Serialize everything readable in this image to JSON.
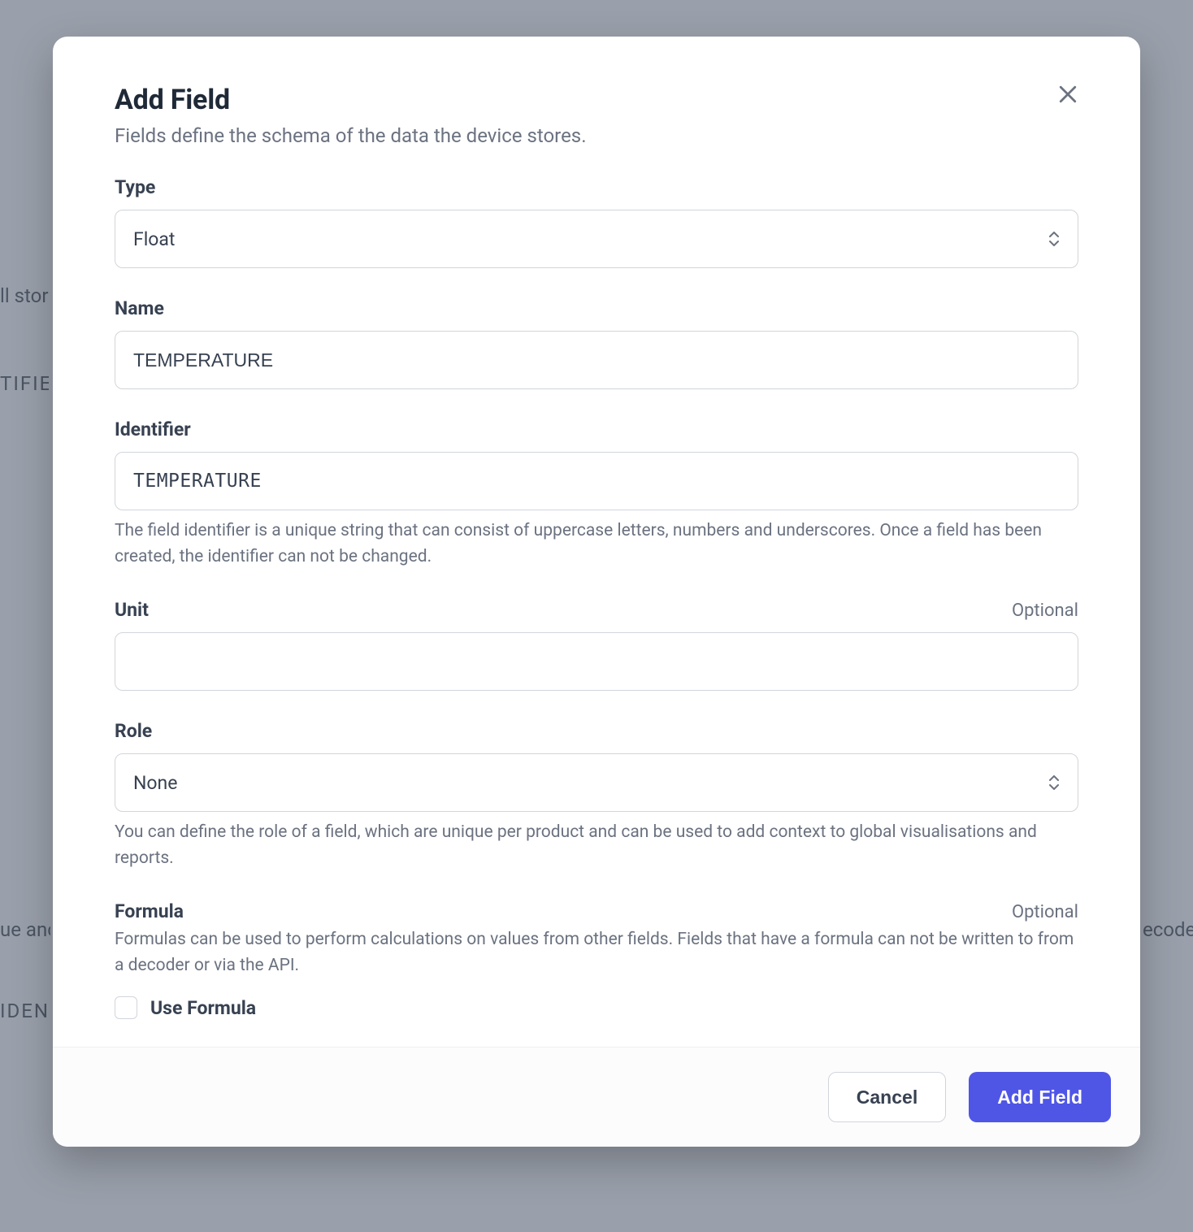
{
  "background": {
    "line1": "ll stor",
    "line2": "TIFIE",
    "line3": "ue anc",
    "line4": "IDEN",
    "line5": "ecode"
  },
  "modal": {
    "title": "Add Field",
    "subtitle": "Fields define the schema of the data the device stores.",
    "type": {
      "label": "Type",
      "value": "Float"
    },
    "name": {
      "label": "Name",
      "value": "TEMPERATURE"
    },
    "identifier": {
      "label": "Identifier",
      "value": "TEMPERATURE",
      "help": "The field identifier is a unique string that can consist of uppercase letters, numbers and underscores. Once a field has been created, the identifier can not be changed."
    },
    "unit": {
      "label": "Unit",
      "optional": "Optional",
      "value": ""
    },
    "role": {
      "label": "Role",
      "value": "None",
      "help": "You can define the role of a field, which are unique per product and can be used to add context to global visualisations and reports."
    },
    "formula": {
      "label": "Formula",
      "optional": "Optional",
      "help": "Formulas can be used to perform calculations on values from other fields. Fields that have a formula can not be written to from a decoder or via the API.",
      "checkbox_label": "Use Formula"
    },
    "footer": {
      "cancel": "Cancel",
      "submit": "Add Field"
    }
  }
}
